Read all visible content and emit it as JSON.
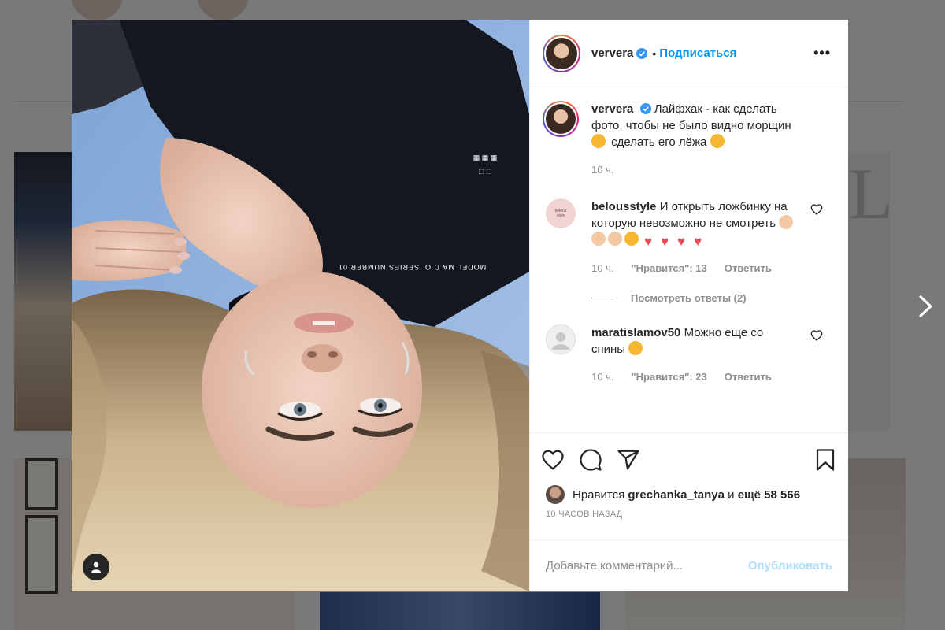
{
  "post": {
    "author": "ververa",
    "follow_label": "Подписаться",
    "dot": "•",
    "more_label": "•••",
    "caption_text": "Лайфхак - как сделать фото, чтобы не было видно морщин",
    "caption_text_2": "сделать его лёжа",
    "caption_time": "10 ч.",
    "likes_prefix": "Нравится",
    "likes_user": "grechanka_tanya",
    "likes_and": "и",
    "likes_rest": "ещё 58 566",
    "time_ago": "10 ЧАСОВ НАЗАД"
  },
  "comments": [
    {
      "user": "belousstyle",
      "text": "И открыть ложбинку на которую невозможно не смотреть",
      "avatar_text": "belous style",
      "time": "10 ч.",
      "likes": "\"Нравится\": 13",
      "reply_label": "Ответить",
      "view_replies": "Посмотреть ответы (2)"
    },
    {
      "user": "maratislamov50",
      "text": "Можно еще со спины",
      "time": "10 ч.",
      "likes": "\"Нравится\": 23",
      "reply_label": "Ответить"
    }
  ],
  "comment_box": {
    "placeholder": "Добавьте комментарий...",
    "publish_label": "Опубликовать"
  },
  "photo_text": {
    "shirt_text": "MODEL MA.D.O. SERIES NUMBER.01"
  },
  "colors": {
    "accent": "#0095f6",
    "publish_disabled": "#b2dffc",
    "heart_red": "#ed4956"
  },
  "icons": {
    "verified": "verified-badge-icon",
    "like": "heart-icon",
    "comment": "comment-bubble-icon",
    "share": "paper-plane-icon",
    "save": "bookmark-icon",
    "tag": "user-tag-icon",
    "next": "chevron-right-icon"
  }
}
